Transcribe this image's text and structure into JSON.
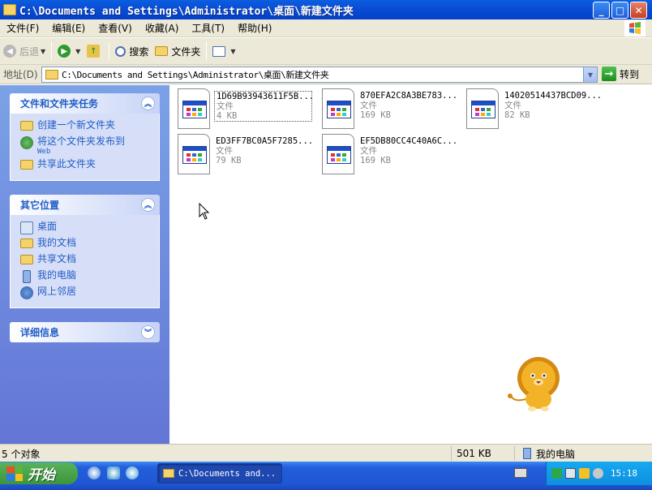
{
  "window": {
    "title": "C:\\Documents and Settings\\Administrator\\桌面\\新建文件夹",
    "min": "_",
    "max": "□",
    "close": "✕"
  },
  "menu": [
    "文件(F)",
    "编辑(E)",
    "查看(V)",
    "收藏(A)",
    "工具(T)",
    "帮助(H)"
  ],
  "toolbar": {
    "back": "后退",
    "search": "搜索",
    "folders": "文件夹"
  },
  "address": {
    "label": "地址(D)",
    "value": "C:\\Documents and Settings\\Administrator\\桌面\\新建文件夹",
    "go": "转到"
  },
  "tasks_panel": {
    "title": "文件和文件夹任务",
    "items": [
      {
        "label": "创建一个新文件夹",
        "sub": ""
      },
      {
        "label": "将这个文件夹发布到",
        "sub": "Web"
      },
      {
        "label": "共享此文件夹",
        "sub": ""
      }
    ]
  },
  "places_panel": {
    "title": "其它位置",
    "items": [
      {
        "label": "桌面"
      },
      {
        "label": "我的文档"
      },
      {
        "label": "共享文档"
      },
      {
        "label": "我的电脑"
      },
      {
        "label": "网上邻居"
      }
    ]
  },
  "details_panel": {
    "title": "详细信息"
  },
  "files": [
    {
      "name": "1D69B93943611F5B...",
      "type": "文件",
      "size": "4 KB",
      "selected": true
    },
    {
      "name": "870EFA2C8A3BE783...",
      "type": "文件",
      "size": "169 KB",
      "selected": false
    },
    {
      "name": "14020514437BCD09...",
      "type": "文件",
      "size": "82 KB",
      "selected": false
    },
    {
      "name": "ED3FF7BC0A5F7285...",
      "type": "文件",
      "size": "79 KB",
      "selected": false
    },
    {
      "name": "EF5DB80CC4C40A6C...",
      "type": "文件",
      "size": "169 KB",
      "selected": false
    }
  ],
  "status": {
    "count": "5 个对象",
    "size": "501 KB",
    "location": "我的电脑"
  },
  "taskbar": {
    "start": "开始",
    "task": "C:\\Documents and...",
    "clock": "15:18"
  }
}
